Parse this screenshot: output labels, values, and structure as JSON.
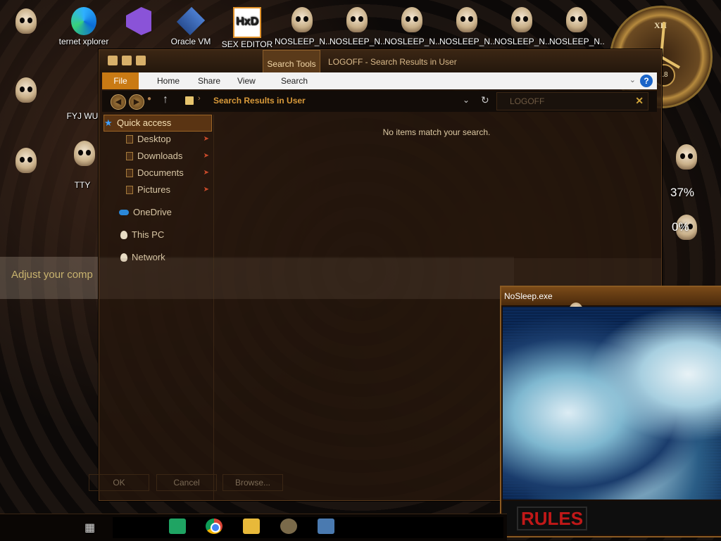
{
  "desktop": {
    "icons": [
      {
        "label": "ternet xplorer",
        "icon": "ie-edge-icon"
      },
      {
        "label": "",
        "icon": "visual-studio-icon"
      },
      {
        "label": "Oracle VM",
        "icon": "virtualbox-icon"
      },
      {
        "label": "SEX EDITOR",
        "icon": "hxd-icon",
        "glyph": "HxD"
      },
      {
        "label": "NOSLEEP_N..."
      },
      {
        "label": "NOSLEEP_N..."
      },
      {
        "label": "NOSLEEP_N..."
      },
      {
        "label": "NOSLEEP_N..."
      },
      {
        "label": "NOSLEEP_N..."
      },
      {
        "label": "NOSLEEP_N..."
      }
    ],
    "left_icons": [
      "FYJ WU",
      "TTY"
    ],
    "clock": {
      "numeral_top": "XII",
      "dial": "18"
    },
    "gauge": {
      "c_percent": "37%",
      "d_percent": "0%"
    }
  },
  "explorer": {
    "title": "LOGOFF - Search Results in User",
    "search_tools_tab": "Search Tools",
    "tabs": [
      "File",
      "Home",
      "Share",
      "View",
      "Search"
    ],
    "help": "?",
    "address": "Search Results in User",
    "search_value": "LOGOFF",
    "empty_message": "No items match your search.",
    "nav": {
      "quick_access": "Quick access",
      "items": [
        "Desktop",
        "Downloads",
        "Documents",
        "Pictures"
      ],
      "onedrive": "OneDrive",
      "this_pc": "This PC",
      "network": "Network"
    }
  },
  "ghost_dialog": {
    "title": "Adjust your comp",
    "buttons": [
      "OK",
      "Cancel",
      "Browse..."
    ]
  },
  "nosleep": {
    "title": "NoSleep.exe",
    "rules": "RULES"
  },
  "colors": {
    "accent": "#c97a14",
    "address_text": "#d99a3a",
    "rules_red": "#c01818"
  }
}
